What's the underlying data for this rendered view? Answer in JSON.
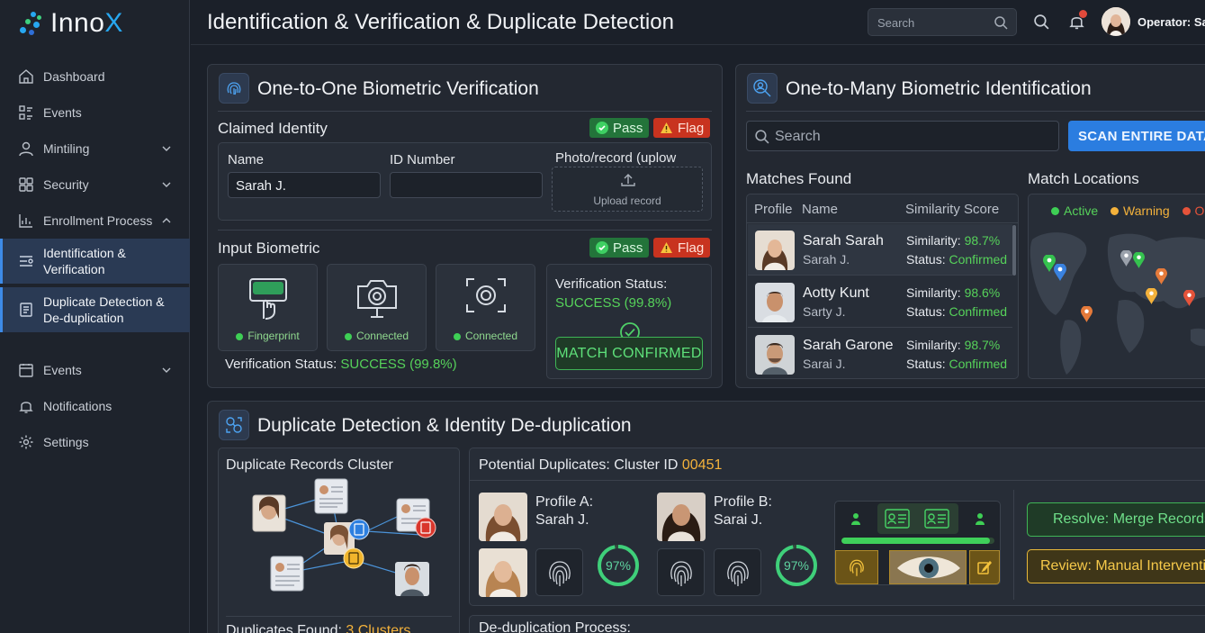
{
  "app": {
    "logo_prefix": "Inno",
    "logo_suffix": "X"
  },
  "header": {
    "title": "Identification & Verification & Duplicate Detection",
    "search_placeholder": "Search",
    "notification_count": "",
    "operator": "Operator: Sar"
  },
  "sidebar": {
    "items": [
      {
        "label": "Dashboard",
        "icon": "home-icon"
      },
      {
        "label": "Events",
        "icon": "list-icon"
      },
      {
        "label": "Mintiling",
        "icon": "user-icon",
        "chevron": "down"
      },
      {
        "label": "Security",
        "icon": "grid-icon",
        "chevron": "down"
      },
      {
        "label": "Enrollment Process",
        "icon": "chart-icon",
        "chevron": "up"
      },
      {
        "label": "Identification & Verification",
        "icon": "id-list-icon",
        "active": true
      },
      {
        "label": "Duplicate Detection & De-duplication",
        "icon": "document-icon",
        "active": true
      },
      {
        "label": "Events",
        "icon": "calendar-icon",
        "chevron": "down"
      },
      {
        "label": "Notifications",
        "icon": "bell-icon"
      },
      {
        "label": "Settings",
        "icon": "gear-icon"
      }
    ]
  },
  "verification": {
    "title": "One-to-One Biometric Verification",
    "claimed_label": "Claimed Identity",
    "pass": "Pass",
    "flag": "Flag",
    "name_label": "Name",
    "name_value": "Sarah J.",
    "id_label": "ID Number",
    "id_value": "",
    "photo_label": "Photo/record (uplow",
    "upload_label": "Upload record",
    "input_label": "Input Biometric",
    "tiles": [
      {
        "status": "Fingerprint",
        "icon": "fingerprint-scanner-icon"
      },
      {
        "status": "Connected",
        "icon": "camera-icon"
      },
      {
        "status": "Connected",
        "icon": "iris-scanner-icon"
      }
    ],
    "status_label": "Verification Status:",
    "status_value": "SUCCESS (99.8%)",
    "status_line_label": "Verification Status: ",
    "status_line_value": "SUCCESS (99.8%)",
    "match_button": "MATCH CONFIRMED"
  },
  "identification": {
    "title": "One-to-Many Biometric Identification",
    "search_placeholder": "Search",
    "scan_button": "SCAN ENTIRE DATAB",
    "matches_label": "Matches Found",
    "columns": [
      "Profile",
      "Name",
      "Similarity Score"
    ],
    "matches": [
      {
        "name": "Sarah Sarah",
        "alias": "Sarah J.",
        "similarity_label": "Similarity: ",
        "similarity": "98.7%",
        "status_label": "Status: ",
        "status": "Confirmed"
      },
      {
        "name": "Aotty Kunt",
        "alias": "Sarty J.",
        "similarity_label": "Similarity: ",
        "similarity": "98.6%",
        "status_label": "Status: ",
        "status": "Confirmed"
      },
      {
        "name": "Sarah Garone",
        "alias": "Sarai J.",
        "similarity_label": "Similarity: ",
        "similarity": "98.7%",
        "status_label": "Status: ",
        "status": "Confirmed"
      }
    ],
    "locations_label": "Match Locations",
    "legend": [
      {
        "label": "Active",
        "color": "#3ecf55"
      },
      {
        "label": "Warning",
        "color": "#f4b23b"
      },
      {
        "label": "O",
        "color": "#e5533a"
      }
    ]
  },
  "dedup": {
    "title": "Duplicate Detection & Identity De-duplication",
    "cluster_label": "Duplicate Records Cluster",
    "found_label": "Duplicates Found: ",
    "found_value": "3 Clusters",
    "potential_label": "Potential Duplicates: Cluster ID ",
    "cluster_id": "00451",
    "profile_a_label": "Profile A:",
    "profile_a_name": "Sarah J.",
    "profile_b_label": "Profile B:",
    "profile_b_name": "Sarai J.",
    "score_a": "97%",
    "score_b": "97%",
    "score_a_fraction": 0.97,
    "score_b_fraction": 0.97,
    "merge_button": "Resolve: Merge Records",
    "review_button": "Review: Manual Interventio",
    "process_label": "De-duplication Process:"
  }
}
